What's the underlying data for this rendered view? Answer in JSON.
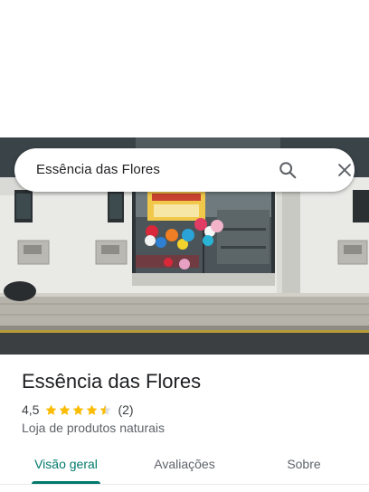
{
  "search": {
    "query": "Essência das Flores"
  },
  "place": {
    "name": "Essência das Flores",
    "rating": "4,5",
    "rating_value": 4.5,
    "rating_max": 5,
    "review_count": "(2)",
    "category": "Loja de produtos naturais"
  },
  "tabs": [
    {
      "label": "Visão geral",
      "active": true
    },
    {
      "label": "Avaliações",
      "active": false
    },
    {
      "label": "Sobre",
      "active": false
    }
  ],
  "colors": {
    "accent": "#00796b",
    "star": "#fbbc04",
    "text_primary": "#202124",
    "text_secondary": "#5f6368"
  },
  "icons": {
    "search": "search-icon",
    "close": "close-icon",
    "star": "star-icon"
  }
}
